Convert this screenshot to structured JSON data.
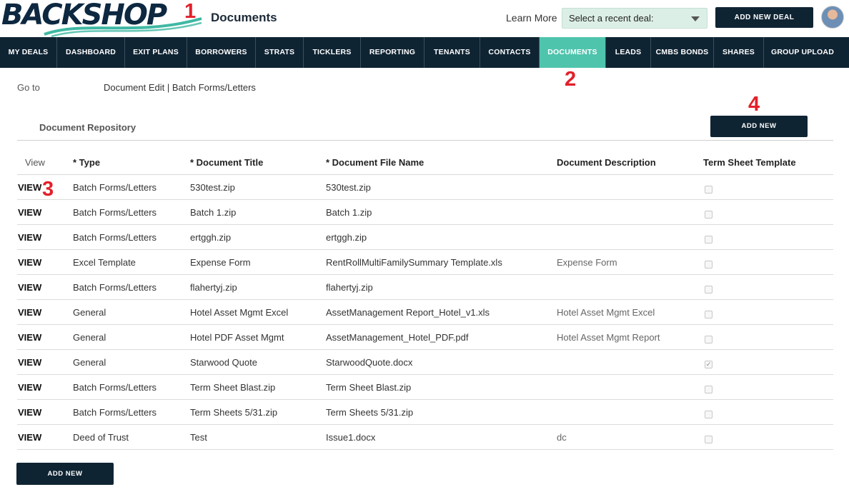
{
  "header": {
    "logo_text": "BACKSHOP",
    "page_title": "Documents",
    "learn_more": "Learn More",
    "deal_select_value": "Select a recent deal:",
    "add_deal_label": "ADD NEW DEAL"
  },
  "nav": {
    "items": [
      {
        "label": "MY DEALS"
      },
      {
        "label": "DASHBOARD"
      },
      {
        "label": "EXIT PLANS"
      },
      {
        "label": "BORROWERS"
      },
      {
        "label": "STRATS"
      },
      {
        "label": "TICKLERS"
      },
      {
        "label": "REPORTING"
      },
      {
        "label": "TENANTS"
      },
      {
        "label": "CONTACTS"
      },
      {
        "label": "DOCUMENTS",
        "active": true
      },
      {
        "label": "LEADS"
      },
      {
        "label": "CMBS BONDS"
      },
      {
        "label": "SHARES"
      },
      {
        "label": "GROUP UPLOAD"
      }
    ]
  },
  "annotations": [
    "1",
    "2",
    "3",
    "4"
  ],
  "goto": {
    "label": "Go to",
    "links": "Document Edit | Batch Forms/Letters"
  },
  "repository": {
    "title": "Document Repository",
    "add_new_label": "ADD NEW"
  },
  "table": {
    "headers": {
      "view": "View",
      "type": "* Type",
      "title": "* Document Title",
      "file": "* Document File Name",
      "desc": "Document Description",
      "template": "Term Sheet Template"
    },
    "rows": [
      {
        "view": "VIEW",
        "type": "Batch Forms/Letters",
        "title": "530test.zip",
        "file": "530test.zip",
        "desc": "",
        "template": false
      },
      {
        "view": "VIEW",
        "type": "Batch Forms/Letters",
        "title": "Batch 1.zip",
        "file": "Batch 1.zip",
        "desc": "",
        "template": false
      },
      {
        "view": "VIEW",
        "type": "Batch Forms/Letters",
        "title": "ertggh.zip",
        "file": "ertggh.zip",
        "desc": "",
        "template": false
      },
      {
        "view": "VIEW",
        "type": "Excel Template",
        "title": "Expense Form",
        "file": "RentRollMultiFamilySummary Template.xls",
        "desc": "Expense Form",
        "template": false
      },
      {
        "view": "VIEW",
        "type": "Batch Forms/Letters",
        "title": "flahertyj.zip",
        "file": "flahertyj.zip",
        "desc": "",
        "template": false
      },
      {
        "view": "VIEW",
        "type": "General",
        "title": "Hotel Asset Mgmt Excel",
        "file": "AssetManagement Report_Hotel_v1.xls",
        "desc": "Hotel Asset Mgmt Excel",
        "template": false
      },
      {
        "view": "VIEW",
        "type": "General",
        "title": "Hotel PDF Asset Mgmt",
        "file": "AssetManagement_Hotel_PDF.pdf",
        "desc": "Hotel Asset Mgmt Report",
        "template": false
      },
      {
        "view": "VIEW",
        "type": "General",
        "title": "Starwood Quote",
        "file": "StarwoodQuote.docx",
        "desc": "",
        "template": true
      },
      {
        "view": "VIEW",
        "type": "Batch Forms/Letters",
        "title": "Term Sheet Blast.zip",
        "file": "Term Sheet Blast.zip",
        "desc": "",
        "template": false
      },
      {
        "view": "VIEW",
        "type": "Batch Forms/Letters",
        "title": "Term Sheets 5/31.zip",
        "file": "Term Sheets 5/31.zip",
        "desc": "",
        "template": false
      },
      {
        "view": "VIEW",
        "type": "Deed of Trust",
        "title": "Test",
        "file": "Issue1.docx",
        "desc": "dc",
        "template": false
      }
    ]
  },
  "footer": {
    "add_new_label": "ADD NEW"
  },
  "colors": {
    "nav_bg": "#0f2433",
    "nav_active": "#4fc4ad",
    "annotation": "#e3202a",
    "select_bg": "#dcefe6"
  }
}
